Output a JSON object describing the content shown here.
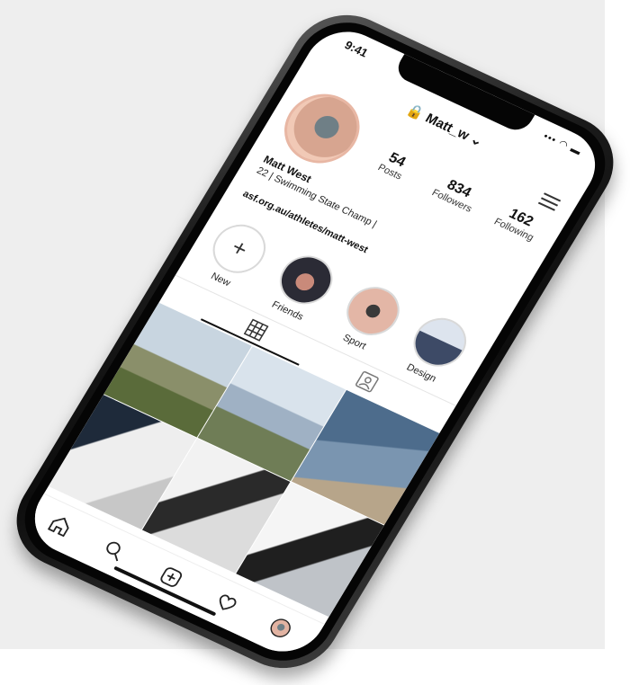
{
  "status_bar": {
    "time": "9:41",
    "icons": "••• ◠ ▬"
  },
  "header": {
    "username": "🔒 Matt_w ⌄",
    "menu_icon": "hamburger-icon"
  },
  "profile": {
    "stats": [
      {
        "value": "54",
        "label": "Posts"
      },
      {
        "value": "834",
        "label": "Followers"
      },
      {
        "value": "162",
        "label": "Following"
      }
    ],
    "name": "Matt West",
    "bio": "22 | Swimming State Champ |",
    "link": "asf.org.au/athletes/matt-west"
  },
  "stories": [
    {
      "label": "New"
    },
    {
      "label": "Friends"
    },
    {
      "label": "Sport"
    },
    {
      "label": "Design"
    }
  ],
  "tabs": [
    {
      "icon": "grid-icon"
    },
    {
      "icon": "tagged-icon"
    }
  ],
  "bottom_nav": [
    {
      "icon": "home-icon"
    },
    {
      "icon": "search-icon"
    },
    {
      "icon": "add-post-icon"
    },
    {
      "icon": "heart-icon"
    },
    {
      "icon": "profile-avatar-icon"
    }
  ]
}
